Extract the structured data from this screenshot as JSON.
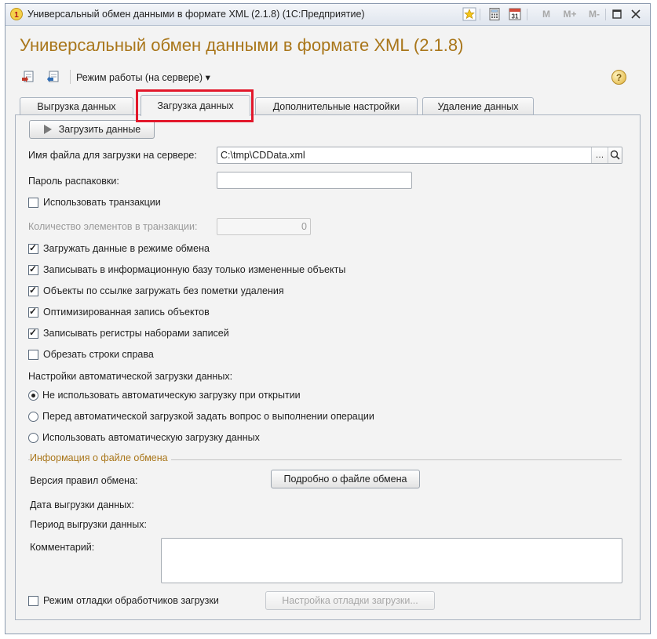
{
  "window": {
    "title": "Универсальный обмен данными в формате XML (2.1.8)  (1С:Предприятие)",
    "buttons": {
      "m": "M",
      "m_plus": "M+",
      "m_minus": "M-"
    }
  },
  "form": {
    "title": "Универсальный обмен данными в формате XML (2.1.8)",
    "mode_menu": "Режим работы (на сервере) ▾"
  },
  "tabs": [
    {
      "label": "Выгрузка данных"
    },
    {
      "label": "Загрузка данных"
    },
    {
      "label": "Дополнительные настройки"
    },
    {
      "label": "Удаление данных"
    }
  ],
  "load": {
    "load_button": "Загрузить данные",
    "file_label": "Имя файла для загрузки на сервере:",
    "file_value": "C:\\tmp\\CDData.xml",
    "password_label": "Пароль распаковки:",
    "password_value": "",
    "use_transactions": "Использовать транзакции",
    "count_label": "Количество элементов в транзакции:",
    "count_value": "0",
    "options": [
      {
        "label": "Загружать данные в режиме обмена",
        "checked": true
      },
      {
        "label": "Записывать в информационную базу только измененные объекты",
        "checked": true
      },
      {
        "label": "Объекты по ссылке загружать без пометки удаления",
        "checked": true
      },
      {
        "label": "Оптимизированная запись объектов",
        "checked": true
      },
      {
        "label": "Записывать регистры наборами записей",
        "checked": true
      },
      {
        "label": "Обрезать строки справа",
        "checked": false
      }
    ],
    "auto_label": "Настройки автоматической загрузки данных:",
    "auto_options": [
      {
        "label": "Не использовать автоматическую загрузку при открытии",
        "checked": true
      },
      {
        "label": "Перед автоматической загрузкой задать вопрос о выполнении операции",
        "checked": false
      },
      {
        "label": "Использовать автоматическую загрузку данных",
        "checked": false
      }
    ]
  },
  "info": {
    "group_title": "Информация о файле обмена",
    "rules_version": "Версия правил обмена:",
    "details_button": "Подробно о файле обмена",
    "export_date": "Дата выгрузки данных:",
    "export_period": "Период выгрузки данных:",
    "comment": "Комментарий:"
  },
  "debug": {
    "debug_mode": "Режим отладки обработчиков загрузки",
    "debug_settings_button": "Настройка отладки загрузки..."
  }
}
